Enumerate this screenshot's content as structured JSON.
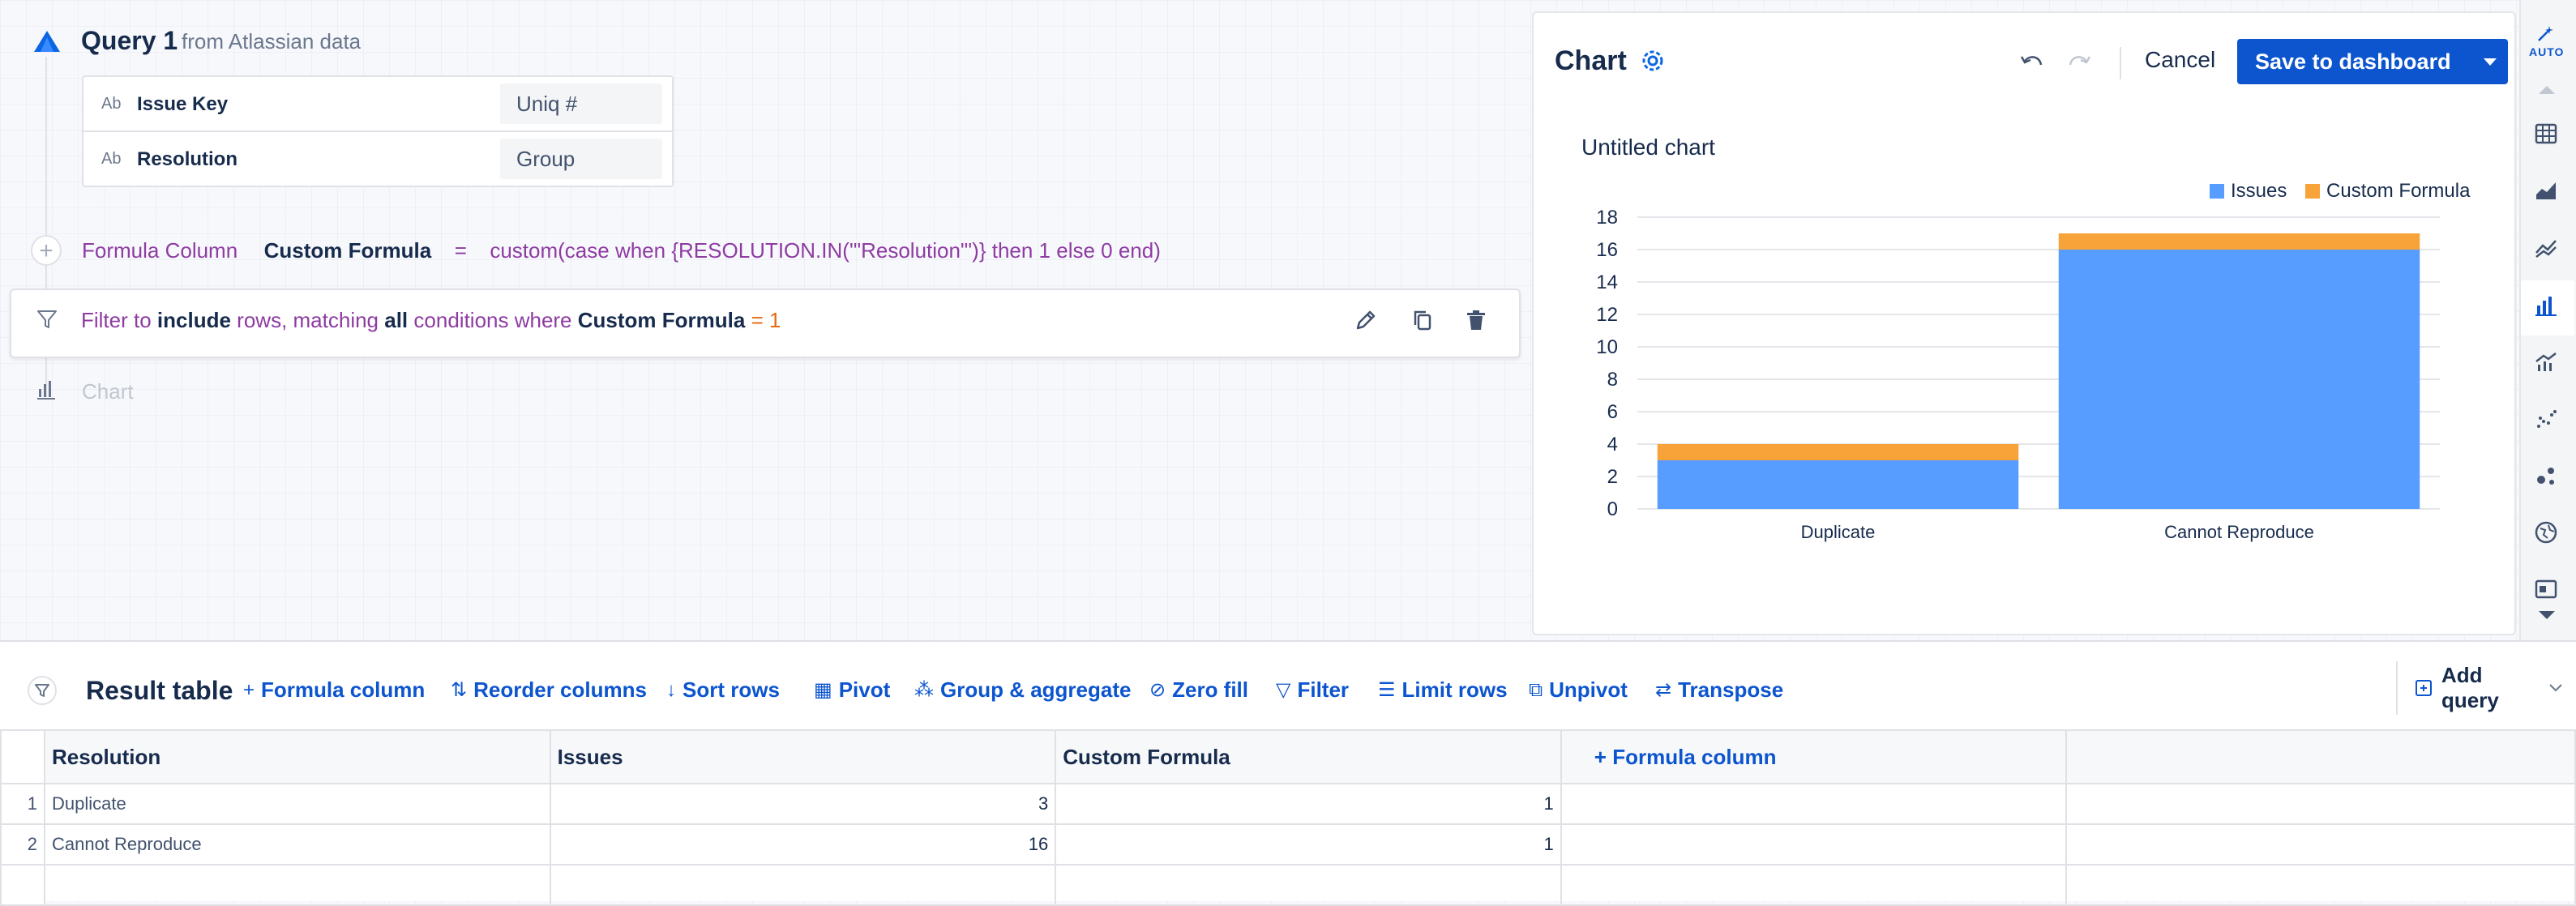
{
  "query": {
    "title": "Query 1",
    "from_label": "from",
    "source": "Atlassian data",
    "fields": [
      {
        "type": "Ab",
        "name": "Issue Key",
        "aggregation": "Uniq #"
      },
      {
        "type": "Ab",
        "name": "Resolution",
        "aggregation": "Group"
      }
    ],
    "formula": {
      "label": "Formula Column",
      "name": "Custom Formula",
      "equals": "=",
      "expression": "custom(case when {RESOLUTION.IN('\"Resolution\"')} then 1 else 0 end)"
    },
    "filter": {
      "p1": "Filter to",
      "mode": "include",
      "p2": "rows, matching",
      "match": "all",
      "p3": "conditions where",
      "field": "Custom Formula",
      "op": "=",
      "value": "1"
    },
    "chart_step_label": "Chart"
  },
  "chart_panel": {
    "heading": "Chart",
    "cancel": "Cancel",
    "save": "Save to dashboard"
  },
  "chart_data": {
    "type": "bar",
    "stacked": true,
    "title": "Untitled chart",
    "categories": [
      "Duplicate",
      "Cannot Reproduce"
    ],
    "series": [
      {
        "name": "Issues",
        "values": [
          3,
          16
        ],
        "color": "#579dff"
      },
      {
        "name": "Custom Formula",
        "values": [
          1,
          1
        ],
        "color": "#f8a23a"
      }
    ],
    "ylim": [
      0,
      18
    ],
    "yticks": [
      "0",
      "2",
      "4",
      "6",
      "8",
      "10",
      "12",
      "14",
      "16",
      "18"
    ],
    "xlabel": "",
    "ylabel": "",
    "legend": "top-right",
    "grid": true
  },
  "rail": {
    "auto_label": "AUTO"
  },
  "result": {
    "title": "Result table",
    "toolbar": [
      {
        "icon": "+",
        "label": "Formula column"
      },
      {
        "icon": "⇅",
        "label": "Reorder columns"
      },
      {
        "icon": "↓",
        "label": "Sort rows"
      },
      {
        "icon": "▦",
        "label": "Pivot"
      },
      {
        "icon": "⁂",
        "label": "Group & aggregate"
      },
      {
        "icon": "⊘",
        "label": "Zero fill"
      },
      {
        "icon": "▽",
        "label": "Filter"
      },
      {
        "icon": "☰",
        "label": "Limit rows"
      },
      {
        "icon": "⧉",
        "label": "Unpivot"
      },
      {
        "icon": "⇄",
        "label": "Transpose"
      }
    ],
    "add_query": "Add query",
    "columns": [
      "Resolution",
      "Issues",
      "Custom Formula"
    ],
    "add_column_label": "Formula column",
    "rows": [
      {
        "n": "1",
        "resolution": "Duplicate",
        "issues": "3",
        "custom": "1"
      },
      {
        "n": "2",
        "resolution": "Cannot Reproduce",
        "issues": "16",
        "custom": "1"
      }
    ]
  },
  "colors": {
    "accent": "#0c55cf",
    "issues": "#579dff",
    "formula": "#f8a23a",
    "purple": "#8e3ba2"
  }
}
